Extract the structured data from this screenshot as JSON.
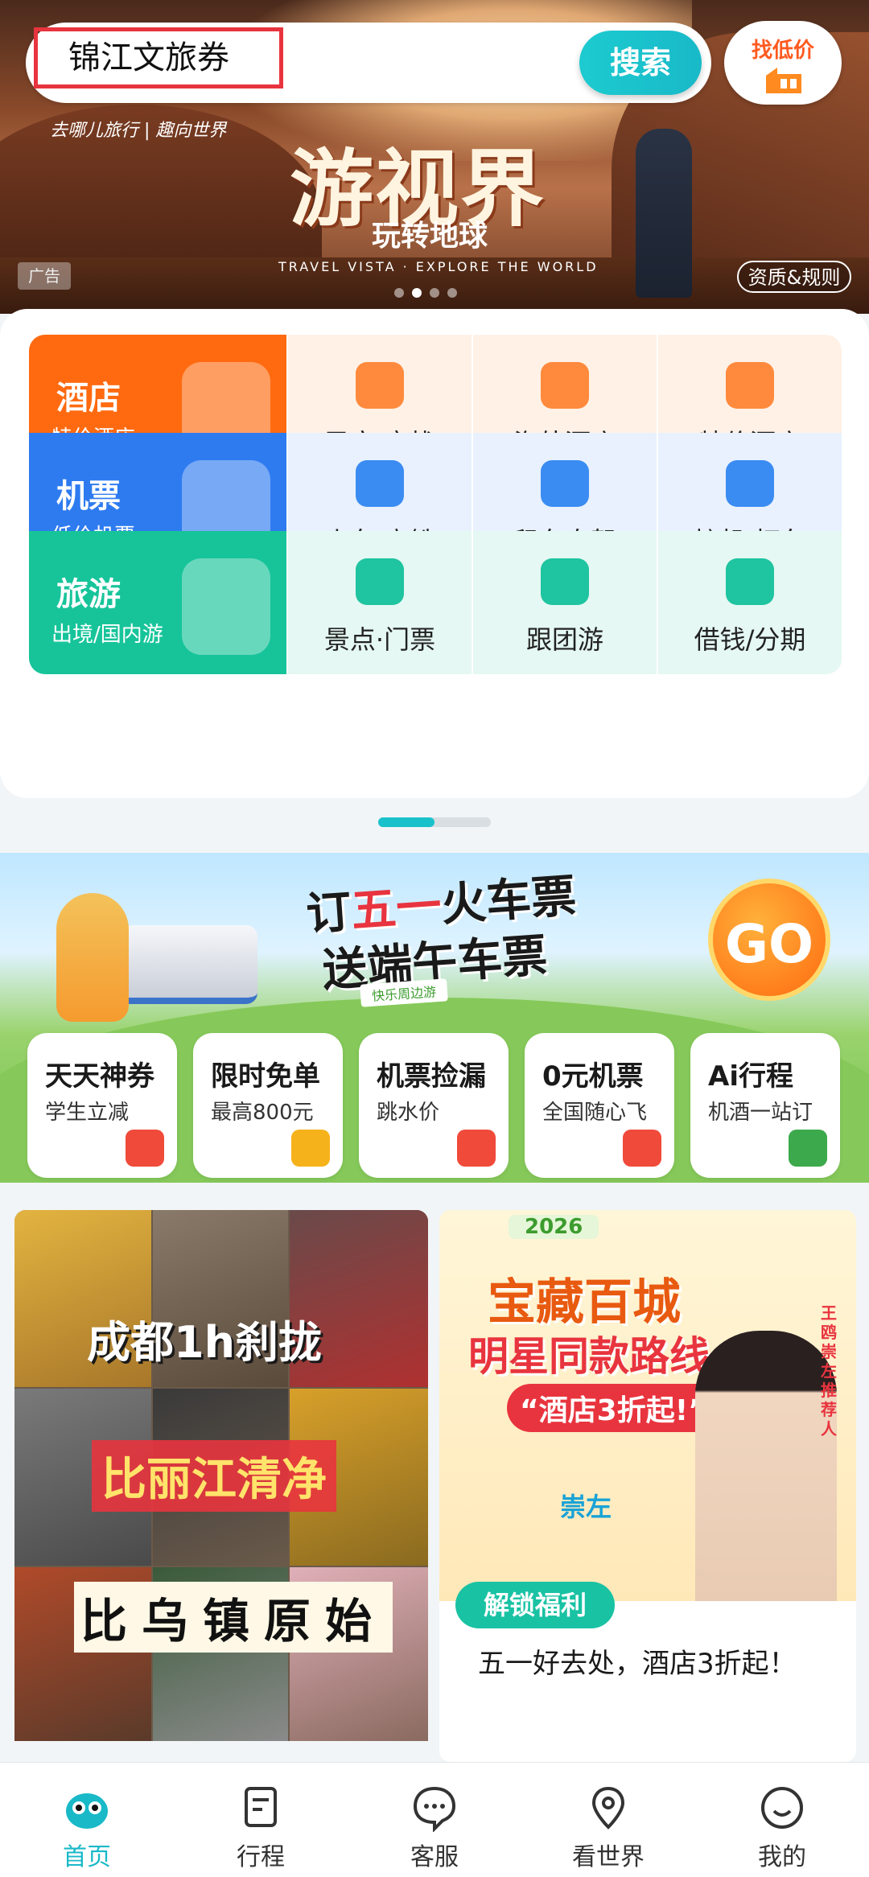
{
  "search": {
    "query": "锦江文旅券",
    "button_label": "搜索"
  },
  "price_finder": {
    "label": "找低价"
  },
  "hero": {
    "brand": "去哪儿旅行 | 趣向世界",
    "title": "游视界",
    "subtitle": "玩转地球",
    "tagline": "TRAVEL VISTA · EXPLORE THE WORLD",
    "ad_label": "广告",
    "rules_label": "资质&规则",
    "carousel": {
      "count": 4,
      "active_index": 2
    }
  },
  "grid": {
    "rows": [
      {
        "main": {
          "title": "酒店",
          "subtitle": "特价酒店",
          "color": "#ff6a10",
          "icon": "hotel-building-icon"
        },
        "bg": "#fff1e6",
        "items": [
          {
            "label": "民宿·客栈",
            "icon": "house-icon",
            "color": "#ff8a3d"
          },
          {
            "label": "海外酒店",
            "icon": "building-icon",
            "color": "#ff8a3d"
          },
          {
            "label": "特价酒店",
            "icon": "alarm-clock-icon",
            "color": "#ff8a3d"
          }
        ]
      },
      {
        "main": {
          "title": "机票",
          "subtitle": "低价机票",
          "color": "#2e7bf0",
          "icon": "airplane-icon"
        },
        "bg": "#e8f1fd",
        "items": [
          {
            "label": "火车·高铁",
            "icon": "train-icon",
            "color": "#3b8cf2"
          },
          {
            "label": "租车自驾",
            "icon": "car-icon",
            "color": "#3b8cf2"
          },
          {
            "label": "接机/打车",
            "icon": "plane-car-icon",
            "color": "#3b8cf2"
          }
        ]
      },
      {
        "main": {
          "title": "旅游",
          "subtitle": "出境/国内游",
          "color": "#17c49a",
          "icon": "palm-tree-icon"
        },
        "bg": "#e5f8f3",
        "items": [
          {
            "label": "景点·门票",
            "icon": "ticket-icon",
            "color": "#1fc4a0"
          },
          {
            "label": "跟团游",
            "icon": "location-pin-icon",
            "color": "#1fc4a0"
          },
          {
            "label": "借钱/分期",
            "icon": "money-bag-icon",
            "color": "#1fc4a0"
          }
        ]
      }
    ]
  },
  "promo": {
    "line1_prefix": "订",
    "line1_highlight": "五一",
    "line1_suffix": "火车票",
    "line2": "送端午车票",
    "tag": "快乐周边游",
    "go_label": "GO"
  },
  "deals": [
    {
      "title": "天天神券",
      "sub": "学生立减",
      "icon": "red-packet-icon",
      "color": "#f04a3a"
    },
    {
      "title": "限时免单",
      "sub": "最高800元",
      "icon": "mascot-icon",
      "color": "#f5b21a"
    },
    {
      "title": "机票捡漏",
      "sub": "跳水价",
      "icon": "lightning-icon",
      "color": "#f04a3a"
    },
    {
      "title": "0元机票",
      "sub": "全国随心飞",
      "icon": "ticket-icon",
      "color": "#f04a3a"
    },
    {
      "title": "Ai行程",
      "sub": "机酒一站订",
      "icon": "map-cube-icon",
      "color": "#3ca94c"
    }
  ],
  "feed": {
    "left": {
      "line1": "成都1h刹拢",
      "line2": "比丽江清净",
      "line3": "比乌镇原始"
    },
    "right": {
      "year": "2026",
      "line1": "宝藏百城",
      "line2": "明星同款路线",
      "line3": "“酒店3折起!”",
      "side_text": "崇左推荐人",
      "name": "王鸥",
      "place": "崇左",
      "badge": "解锁福利",
      "caption": "五一好去处，酒店3折起！"
    }
  },
  "nav": {
    "items": [
      {
        "label": "首页",
        "icon": "home-mascot-icon",
        "active": true
      },
      {
        "label": "行程",
        "icon": "itinerary-icon",
        "active": false
      },
      {
        "label": "客服",
        "icon": "chat-bubble-icon",
        "active": false
      },
      {
        "label": "看世界",
        "icon": "location-pin-icon",
        "active": false
      },
      {
        "label": "我的",
        "icon": "smiley-icon",
        "active": false
      }
    ]
  },
  "colors": {
    "accent": "#19b9c8",
    "alert": "#e8343e"
  }
}
